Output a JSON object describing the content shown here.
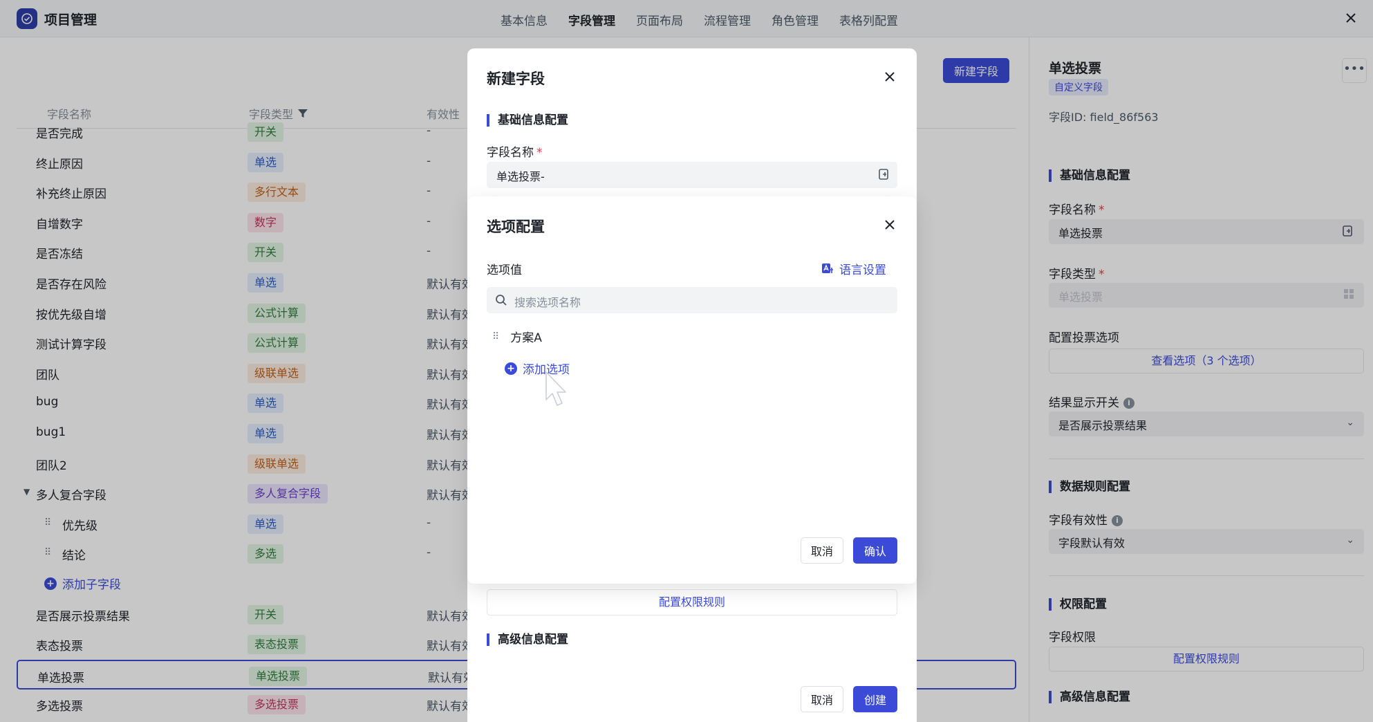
{
  "app": {
    "title": "项目管理"
  },
  "nav": {
    "tabs": [
      {
        "label": "基本信息",
        "active": false
      },
      {
        "label": "字段管理",
        "active": true
      },
      {
        "label": "页面布局",
        "active": false
      },
      {
        "label": "流程管理",
        "active": false
      },
      {
        "label": "角色管理",
        "active": false
      },
      {
        "label": "表格列配置",
        "active": false
      }
    ]
  },
  "toolbar": {
    "new_field_label": "新建字段"
  },
  "table": {
    "headers": {
      "name": "字段名称",
      "type": "字段类型",
      "validity": "有效性"
    },
    "rows": [
      {
        "name": "是否完成",
        "type": "开关",
        "type_color": "green",
        "validity": "-"
      },
      {
        "name": "终止原因",
        "type": "单选",
        "type_color": "blue",
        "validity": "-"
      },
      {
        "name": "补充终止原因",
        "type": "多行文本",
        "type_color": "orange",
        "validity": "-"
      },
      {
        "name": "自增数字",
        "type": "数字",
        "type_color": "pink",
        "validity": "-"
      },
      {
        "name": "是否冻结",
        "type": "开关",
        "type_color": "green",
        "validity": "-"
      },
      {
        "name": "是否存在风险",
        "type": "单选",
        "type_color": "blue",
        "validity": "默认有效"
      },
      {
        "name": "按优先级自增",
        "type": "公式计算",
        "type_color": "green",
        "validity": "默认有效"
      },
      {
        "name": "测试计算字段",
        "type": "公式计算",
        "type_color": "green",
        "validity": "默认有效"
      },
      {
        "name": "团队",
        "type": "级联单选",
        "type_color": "orange",
        "validity": "默认有效"
      },
      {
        "name": "bug",
        "type": "单选",
        "type_color": "blue",
        "validity": "默认有效"
      },
      {
        "name": "bug1",
        "type": "单选",
        "type_color": "blue",
        "validity": "默认有效"
      },
      {
        "name": "团队2",
        "type": "级联单选",
        "type_color": "orange",
        "validity": "默认有效"
      },
      {
        "name": "多人复合字段",
        "type": "多人复合字段",
        "type_color": "purple",
        "validity": "默认有效",
        "expandable": true
      },
      {
        "name": "优先级",
        "type": "单选",
        "type_color": "blue",
        "validity": "-",
        "child": true
      },
      {
        "name": "结论",
        "type": "多选",
        "type_color": "green",
        "validity": "-",
        "child": true
      }
    ],
    "add_sub_field": "添加子字段",
    "rows_after": [
      {
        "name": "是否展示投票结果",
        "type": "开关",
        "type_color": "green",
        "validity": "默认有效"
      },
      {
        "name": "表态投票",
        "type": "表态投票",
        "type_color": "green",
        "validity": "默认有效"
      },
      {
        "name": "单选投票",
        "type": "单选投票",
        "type_color": "green",
        "validity": "默认有效",
        "selected": true
      },
      {
        "name": "多选投票",
        "type": "多选投票",
        "type_color": "pink",
        "validity": "默认有效"
      }
    ]
  },
  "right_panel": {
    "title": "单选投票",
    "badge": "自定义字段",
    "field_id": "字段ID:  field_86f563",
    "more": "•••",
    "section_basic": "基础信息配置",
    "name_label": "字段名称",
    "name_value": "单选投票",
    "type_label": "字段类型",
    "type_value": "单选投票",
    "vote_options_label": "配置投票选项",
    "vote_options_link": "查看选项（3 个选项）",
    "result_switch_label": "结果显示开关",
    "result_switch_value": "是否展示投票结果",
    "section_rules": "数据规则配置",
    "validity_label": "字段有效性",
    "validity_value": "字段默认有效",
    "section_perm": "权限配置",
    "perm_label": "字段权限",
    "perm_link": "配置权限规则",
    "section_adv": "高级信息配置",
    "required_mark": "*",
    "info_mark": "i"
  },
  "modal_new_field": {
    "title": "新建字段",
    "section_basic": "基础信息配置",
    "name_label": "字段名称",
    "name_value": "单选投票-",
    "perm_link": "配置权限规则",
    "section_adv": "高级信息配置",
    "cancel_label": "取消",
    "create_label": "创建",
    "required_mark": "*"
  },
  "modal_options": {
    "title": "选项配置",
    "values_label": "选项值",
    "lang_settings": "语言设置",
    "search_placeholder": "搜索选项名称",
    "options": [
      "方案A"
    ],
    "add_option": "添加选项",
    "cancel_label": "取消",
    "confirm_label": "确认"
  },
  "colors": {
    "accent": "#3b4bd8",
    "overlay": "rgba(0,0,0,0.22)"
  }
}
